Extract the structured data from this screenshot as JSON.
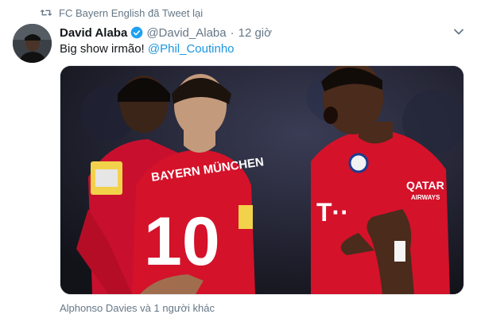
{
  "retweet": {
    "icon": "retweet-icon",
    "text": "FC Bayern English đã Tweet lại"
  },
  "tweet": {
    "author": {
      "display_name": "David Alaba",
      "verified_icon": "verified-badge-icon",
      "handle": "@David_Alaba",
      "separator": "·",
      "time": "12 giờ"
    },
    "text_prefix": "Big show irmão! ",
    "mention": "@Phil_Coutinho",
    "media": {
      "description_icon": "photo",
      "shirt_text": "BAYERN MÜNCHEN",
      "shirt_number": "10",
      "sponsor": "QATAR AIRWAYS"
    },
    "likes_text": "Alphonso Davies và 1 người khác"
  },
  "colors": {
    "accent": "#1b95e0",
    "muted": "#657786",
    "verified": "#1da1f2",
    "jersey_red": "#d4122a"
  }
}
